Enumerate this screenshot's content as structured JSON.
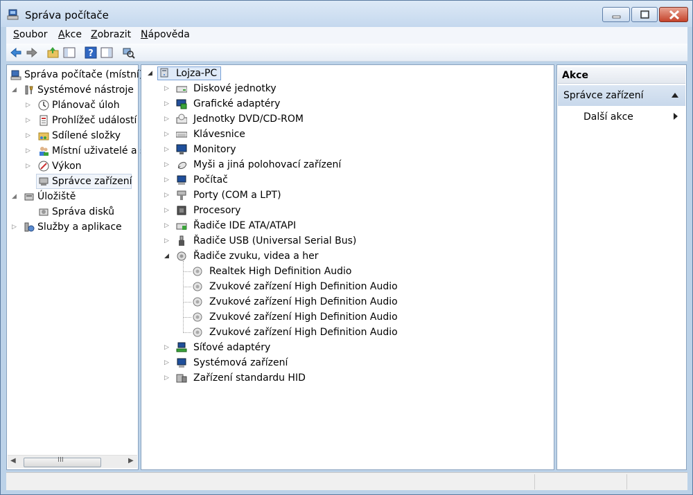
{
  "window": {
    "title": "Správa počítače",
    "minimize_icon": "minimize-icon",
    "maximize_icon": "maximize-icon",
    "close_icon": "close-icon"
  },
  "menu": [
    {
      "label": "Soubor",
      "accel": "S",
      "rest": "oubor"
    },
    {
      "label": "Akce",
      "accel": "A",
      "rest": "kce"
    },
    {
      "label": "Zobrazit",
      "accel": "Z",
      "rest": "obrazit"
    },
    {
      "label": "Nápověda",
      "accel": "N",
      "rest": "ápověda"
    }
  ],
  "toolbar": [
    {
      "icon": "back-arrow-icon"
    },
    {
      "icon": "forward-arrow-icon"
    },
    {
      "icon": "up-folder-icon"
    },
    {
      "icon": "show-hide-tree-icon"
    },
    {
      "icon": "help-icon"
    },
    {
      "icon": "show-hide-action-pane-icon"
    },
    {
      "icon": "scan-hardware-icon"
    }
  ],
  "left_tree": [
    {
      "label": "Správa počítače (místní)",
      "level": 0,
      "expander": "",
      "icon": "computer-management-icon"
    },
    {
      "label": "Systémové nástroje",
      "level": 1,
      "expander": "expanded",
      "icon": "tools-icon"
    },
    {
      "label": "Plánovač úloh",
      "level": 2,
      "expander": "collapsed",
      "icon": "clock-icon"
    },
    {
      "label": "Prohlížeč událostí",
      "level": 2,
      "expander": "collapsed",
      "icon": "event-viewer-icon"
    },
    {
      "label": "Sdílené složky",
      "level": 2,
      "expander": "collapsed",
      "icon": "shared-folder-icon"
    },
    {
      "label": "Místní uživatelé a s",
      "level": 2,
      "expander": "collapsed",
      "icon": "users-icon"
    },
    {
      "label": "Výkon",
      "level": 2,
      "expander": "collapsed",
      "icon": "performance-icon"
    },
    {
      "label": "Správce zařízení",
      "level": 2,
      "expander": "",
      "icon": "device-manager-icon",
      "selected": true
    },
    {
      "label": "Úložiště",
      "level": 1,
      "expander": "expanded",
      "icon": "storage-icon"
    },
    {
      "label": "Správa disků",
      "level": 2,
      "expander": "",
      "icon": "disk-management-icon"
    },
    {
      "label": "Služby a aplikace",
      "level": 1,
      "expander": "collapsed",
      "icon": "services-icon"
    }
  ],
  "device_tree": {
    "root": {
      "label": "Lojza-PC",
      "icon": "computer-icon"
    },
    "categories": [
      {
        "label": "Diskové jednotky",
        "icon": "disk-drive-icon",
        "expanded": false
      },
      {
        "label": "Grafické adaptéry",
        "icon": "display-adapter-icon",
        "expanded": false
      },
      {
        "label": "Jednotky DVD/CD-ROM",
        "icon": "dvd-drive-icon",
        "expanded": false
      },
      {
        "label": "Klávesnice",
        "icon": "keyboard-icon",
        "expanded": false
      },
      {
        "label": "Monitory",
        "icon": "monitor-icon",
        "expanded": false
      },
      {
        "label": "Myši a jiná polohovací zařízení",
        "icon": "mouse-icon",
        "expanded": false
      },
      {
        "label": "Počítač",
        "icon": "computer-small-icon",
        "expanded": false
      },
      {
        "label": "Porty (COM a LPT)",
        "icon": "port-icon",
        "expanded": false
      },
      {
        "label": "Procesory",
        "icon": "processor-icon",
        "expanded": false
      },
      {
        "label": "Řadiče IDE ATA/ATAPI",
        "icon": "ide-controller-icon",
        "expanded": false
      },
      {
        "label": "Řadiče USB (Universal Serial Bus)",
        "icon": "usb-icon",
        "expanded": false
      },
      {
        "label": "Řadiče zvuku, videa a her",
        "icon": "sound-icon",
        "expanded": true,
        "children": [
          {
            "label": "Realtek High Definition Audio",
            "icon": "audio-device-icon"
          },
          {
            "label": "Zvukové zařízení High Definition Audio",
            "icon": "audio-device-icon"
          },
          {
            "label": "Zvukové zařízení High Definition Audio",
            "icon": "audio-device-icon"
          },
          {
            "label": "Zvukové zařízení High Definition Audio",
            "icon": "audio-device-icon"
          },
          {
            "label": "Zvukové zařízení High Definition Audio",
            "icon": "audio-device-icon"
          }
        ]
      },
      {
        "label": "Síťové adaptéry",
        "icon": "network-adapter-icon",
        "expanded": false
      },
      {
        "label": "Systémová zařízení",
        "icon": "system-devices-icon",
        "expanded": false
      },
      {
        "label": "Zařízení standardu HID",
        "icon": "hid-icon",
        "expanded": false
      }
    ]
  },
  "actions": {
    "header": "Akce",
    "section": "Správce zařízení",
    "item": "Další akce"
  },
  "scrollbar": {
    "grip": "III"
  }
}
